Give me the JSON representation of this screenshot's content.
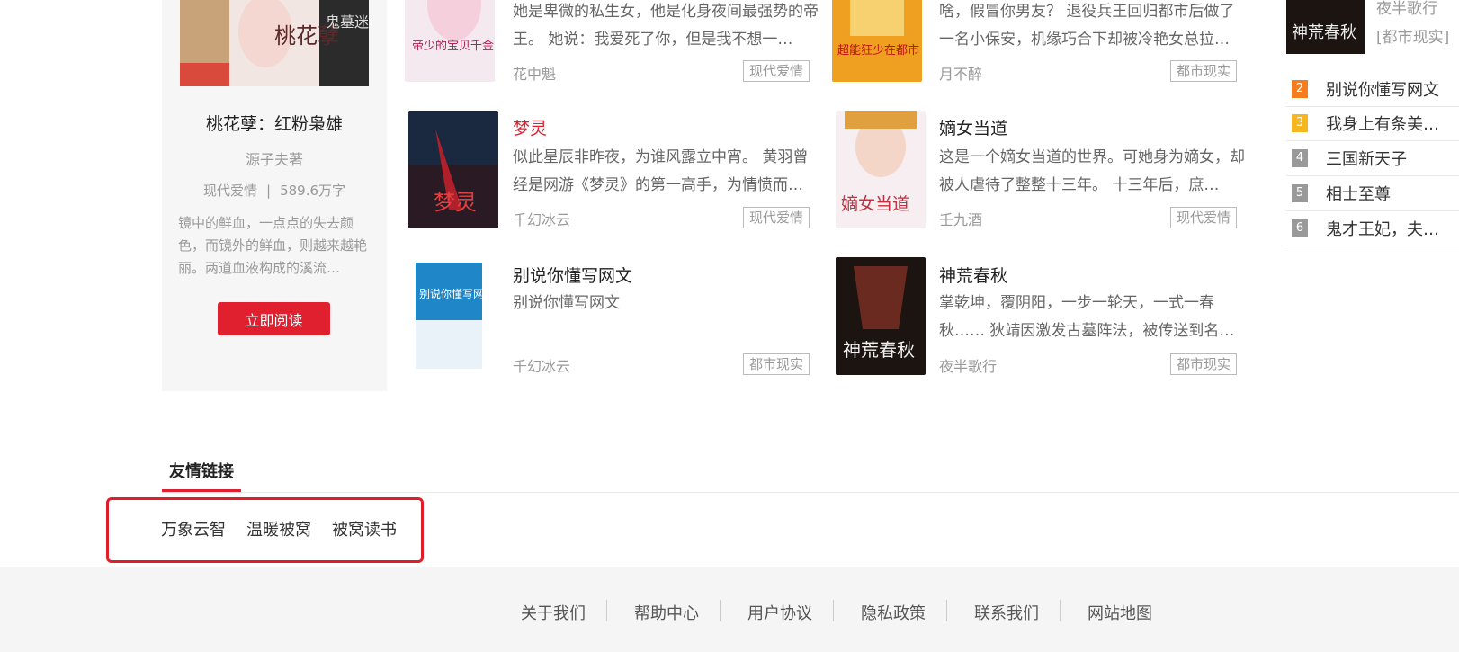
{
  "featured": {
    "title": "桃花孽：红粉枭雄",
    "author": "源子夫著",
    "category": "现代爱情",
    "separator": "|",
    "words": "589.6万字",
    "description": "镜中的鲜血，一点点的失去颜色，而镜外的鲜血，则越来越艳丽。两道血液构成的溪流…",
    "read_button": "立即阅读",
    "cover_texts": [
      "桃花孽",
      "鬼墓迷灯"
    ]
  },
  "books": [
    {
      "title": "",
      "description": "她是卑微的私生女，他是化身夜间最强势的帝王。 她说：我爱死了你，但是我不想一…",
      "author": "花中魁",
      "tag": "现代爱情",
      "cover_text": "帝少的宝贝千金"
    },
    {
      "title": "",
      "description": "啥，假冒你男友？ 退役兵王回归都市后做了一名小保安，机缘巧合下却被冷艳女总拉…",
      "author": "月不醉",
      "tag": "都市现实",
      "cover_text": "超能狂少在都市"
    },
    {
      "title": "梦灵",
      "description": "似此星辰非昨夜，为谁风露立中宵。 黄羽曾经是网游《梦灵》的第一高手，为情愤而…",
      "author": "千幻冰云",
      "tag": "现代爱情",
      "cover_text": "梦灵"
    },
    {
      "title": "嫡女当道",
      "description": "这是一个嫡女当道的世界。可她身为嫡女，却被人虐待了整整十三年。 十三年后，庶…",
      "author": "壬九酒",
      "tag": "现代爱情",
      "cover_text": "嫡女当道"
    },
    {
      "title": "别说你懂写网文",
      "description": "别说你懂写网文",
      "author": "千幻冰云",
      "tag": "都市现实",
      "cover_text": "别说你懂写网文"
    },
    {
      "title": "神荒春秋",
      "description": "掌乾坤，覆阴阳，一步一轮天，一式一春秋…… 狄靖因激发古墓阵法，被传送到名为…",
      "author": "夜半歌行",
      "tag": "都市现实",
      "cover_text": "神荒春秋"
    }
  ],
  "ranking": {
    "top_author": "夜半歌行",
    "top_tag": "[都市现实]",
    "top_cover_text": "神荒春秋",
    "items": [
      {
        "num": "2",
        "name": "别说你懂写网文",
        "color": "#f57c1f"
      },
      {
        "num": "3",
        "name": "我身上有条美…",
        "color": "#f5b61f"
      },
      {
        "num": "4",
        "name": "三国新天子",
        "color": "#999999"
      },
      {
        "num": "5",
        "name": "相士至尊",
        "color": "#999999"
      },
      {
        "num": "6",
        "name": "鬼才王妃，夫…",
        "color": "#999999"
      }
    ]
  },
  "friend_links": {
    "title": "友情链接",
    "links": [
      "万象云智",
      "温暖被窝",
      "被窝读书"
    ]
  },
  "footer": {
    "links": [
      "关于我们",
      "帮助中心",
      "用户协议",
      "隐私政策",
      "联系我们",
      "网站地图"
    ]
  },
  "colors": {
    "accent": "#e0202f",
    "highlight_box": "#e01e2a"
  }
}
